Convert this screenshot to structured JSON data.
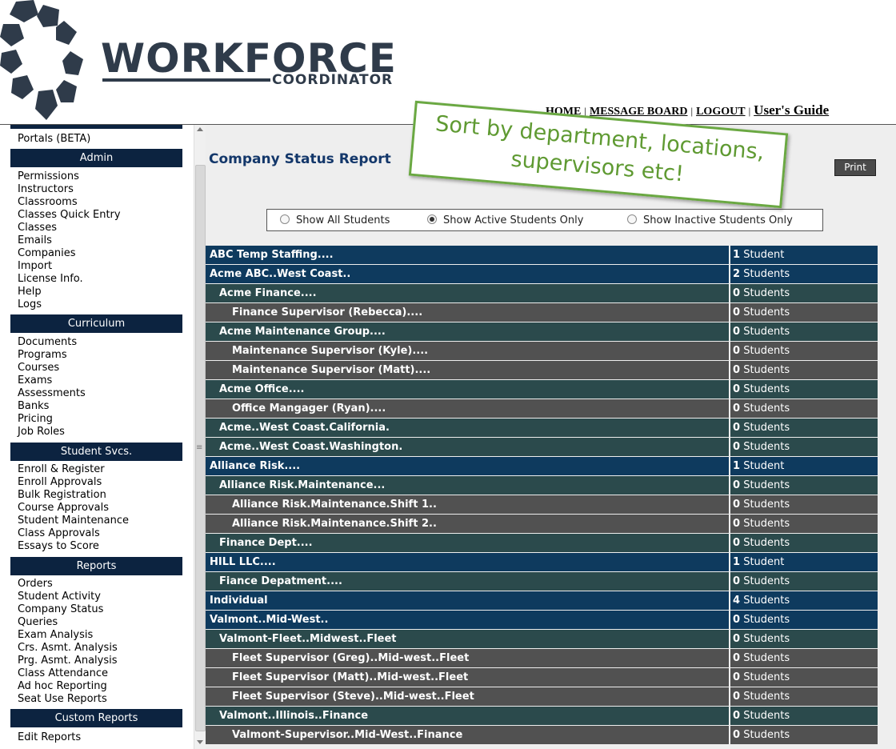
{
  "header": {
    "logo_main": "WORKFORCE",
    "logo_sub": "COORDINATOR",
    "nav": [
      {
        "label": "HOME"
      },
      {
        "label": "MESSAGE BOARD"
      },
      {
        "label": "LOGOUT"
      }
    ],
    "users_guide": "User's Guide",
    "separator": "|"
  },
  "sidebar": {
    "top_item": "Portals (BETA)",
    "sections": [
      {
        "title": "Admin",
        "items": [
          "Permissions",
          "Instructors",
          "Classrooms",
          "Classes Quick Entry",
          "Classes",
          "Emails",
          "Companies",
          "Import",
          "License Info.",
          "Help",
          "Logs"
        ]
      },
      {
        "title": "Curriculum",
        "items": [
          "Documents",
          "Programs",
          "Courses",
          "Exams",
          "Assessments",
          "Banks",
          "Pricing",
          "Job Roles"
        ]
      },
      {
        "title": "Student Svcs.",
        "items": [
          "Enroll & Register",
          "Enroll Approvals",
          "Bulk Registration",
          "Course Approvals",
          "Student Maintenance",
          "Class Approvals",
          "Essays to Score"
        ]
      },
      {
        "title": "Reports",
        "items": [
          "Orders",
          "Student Activity",
          "Company Status",
          "Queries",
          "Exam Analysis",
          "Crs. Asmt. Analysis",
          "Prg. Asmt. Analysis",
          "Class Attendance",
          "Ad hoc Reporting",
          "Seat Use Reports"
        ]
      },
      {
        "title": "Custom Reports",
        "items": [
          "Edit Reports"
        ]
      }
    ]
  },
  "main": {
    "title": "Company Status Report",
    "print_label": "Print",
    "filters": [
      {
        "label": "Show All Students",
        "selected": false
      },
      {
        "label": "Show Active Students Only",
        "selected": true
      },
      {
        "label": "Show Inactive Students Only",
        "selected": false
      }
    ],
    "rows": [
      {
        "name": "ABC Temp Staffing....",
        "level": 0,
        "count": "1",
        "unit": "Student"
      },
      {
        "name": "Acme ABC..West Coast..",
        "level": 0,
        "count": "2",
        "unit": "Students"
      },
      {
        "name": "Acme Finance....",
        "level": 1,
        "count": "0",
        "unit": "Students"
      },
      {
        "name": "Finance Supervisor (Rebecca)....",
        "level": 2,
        "count": "0",
        "unit": "Students"
      },
      {
        "name": "Acme Maintenance Group....",
        "level": 1,
        "count": "0",
        "unit": "Students"
      },
      {
        "name": "Maintenance Supervisor (Kyle)....",
        "level": 2,
        "count": "0",
        "unit": "Students"
      },
      {
        "name": "Maintenance Supervisor (Matt)....",
        "level": 2,
        "count": "0",
        "unit": "Students"
      },
      {
        "name": "Acme Office....",
        "level": 1,
        "count": "0",
        "unit": "Students"
      },
      {
        "name": "Office Mangager (Ryan)....",
        "level": 2,
        "count": "0",
        "unit": "Students"
      },
      {
        "name": "Acme..West Coast.California.",
        "level": 1,
        "count": "0",
        "unit": "Students"
      },
      {
        "name": "Acme..West Coast.Washington.",
        "level": 1,
        "count": "0",
        "unit": "Students"
      },
      {
        "name": "Alliance Risk....",
        "level": 0,
        "count": "1",
        "unit": "Student"
      },
      {
        "name": "Alliance Risk.Maintenance...",
        "level": 1,
        "count": "0",
        "unit": "Students"
      },
      {
        "name": "Alliance Risk.Maintenance.Shift 1..",
        "level": 2,
        "count": "0",
        "unit": "Students"
      },
      {
        "name": "Alliance Risk.Maintenance.Shift 2..",
        "level": 2,
        "count": "0",
        "unit": "Students"
      },
      {
        "name": "Finance Dept....",
        "level": 1,
        "count": "0",
        "unit": "Students"
      },
      {
        "name": "HILL LLC....",
        "level": 0,
        "count": "1",
        "unit": "Student"
      },
      {
        "name": "Fiance Depatment....",
        "level": 1,
        "count": "0",
        "unit": "Students"
      },
      {
        "name": "Individual",
        "level": 0,
        "count": "4",
        "unit": "Students"
      },
      {
        "name": "Valmont..Mid-West..",
        "level": 0,
        "count": "0",
        "unit": "Students"
      },
      {
        "name": "Valmont-Fleet..Midwest..Fleet",
        "level": 1,
        "count": "0",
        "unit": "Students"
      },
      {
        "name": "Fleet Supervisor (Greg)..Mid-west..Fleet",
        "level": 2,
        "count": "0",
        "unit": "Students"
      },
      {
        "name": "Fleet Supervisor (Matt)..Mid-west..Fleet",
        "level": 2,
        "count": "0",
        "unit": "Students"
      },
      {
        "name": "Fleet Supervisor (Steve)..Mid-west..Fleet",
        "level": 2,
        "count": "0",
        "unit": "Students"
      },
      {
        "name": "Valmont..Illinois..Finance",
        "level": 1,
        "count": "0",
        "unit": "Students"
      },
      {
        "name": "Valmont-Supervisor..Mid-West..Finance",
        "level": 2,
        "count": "0",
        "unit": "Students"
      }
    ]
  },
  "callout": {
    "lines": [
      "Sort by department, locations,",
      "supervisors etc!"
    ]
  },
  "colors": {
    "nav_dark": "#0c2340",
    "row_company": "#0e3a5e",
    "row_department": "#2b4a4c",
    "row_supervisor": "#515151",
    "title_blue": "#13376a",
    "callout_green": "#6aa842"
  }
}
